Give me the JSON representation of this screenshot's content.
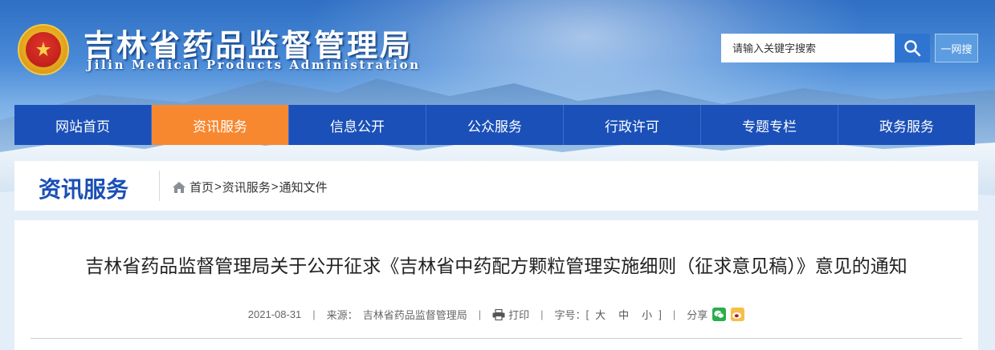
{
  "header": {
    "title": "吉林省药品监督管理局",
    "subtitle": "Jilin Medical Products Administration",
    "emblem_icon": "national-emblem-icon"
  },
  "search": {
    "placeholder": "请输入关键字搜索",
    "button_icon": "search-icon",
    "onenet_label": "一网搜"
  },
  "nav": {
    "items": [
      {
        "label": "网站首页"
      },
      {
        "label": "资讯服务",
        "active": true
      },
      {
        "label": "信息公开"
      },
      {
        "label": "公众服务"
      },
      {
        "label": "行政许可"
      },
      {
        "label": "专题专栏"
      },
      {
        "label": "政务服务"
      }
    ]
  },
  "section": {
    "title": "资讯服务",
    "breadcrumb": {
      "home_icon": "home-icon",
      "items": [
        "首页",
        "资讯服务",
        "通知文件"
      ],
      "separator": ">"
    }
  },
  "article": {
    "title": "吉林省药品监督管理局关于公开征求《吉林省中药配方颗粒管理实施细则（征求意见稿）》意见的通知",
    "meta": {
      "date": "2021-08-31",
      "source_label": "来源：",
      "source": "吉林省药品监督管理局",
      "print_label": "打印",
      "font_size_label": "字号：",
      "font_open": "[",
      "font_sizes": [
        "大",
        "中",
        "小"
      ],
      "font_close": "]",
      "share_label": "分享",
      "separator": "|"
    }
  },
  "colors": {
    "nav_bg": "#1a50b8",
    "nav_active": "#f7882f",
    "section_title": "#1a4fb5",
    "search_btn": "#2f74d0",
    "wechat": "#2aae4a",
    "weibo": "#e6162d"
  }
}
